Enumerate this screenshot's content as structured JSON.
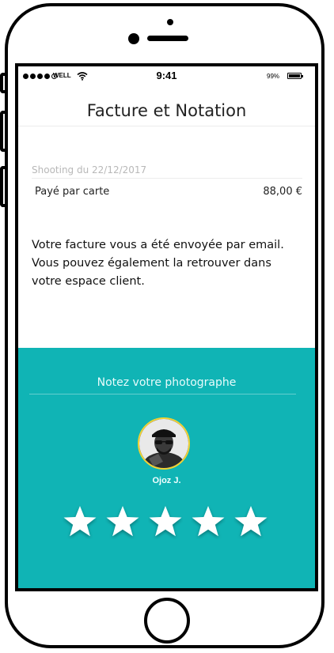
{
  "status_bar": {
    "carrier": "WELL",
    "time": "9:41",
    "battery": "99%",
    "battery_level": 0.99,
    "signal_bars": 4
  },
  "nav": {
    "title": "Facture et Notation"
  },
  "invoice": {
    "shooting_date": "Shooting du 22/12/2017",
    "payment_label": "Payé par carte",
    "amount": "88,00 €"
  },
  "message": "Votre facture vous a été envoyée par email. Vous pouvez également la retrouver dans votre espace client.",
  "rating": {
    "title": "Notez votre photographe",
    "photographer_name": "Ojoz J.",
    "stars_total": 5,
    "panel_color": "#10b4b5",
    "star_color": "#ffffff"
  },
  "icons": {
    "signal": "signal-dots-icon",
    "wifi": "wifi-icon",
    "battery": "battery-icon",
    "star": "star-icon"
  }
}
